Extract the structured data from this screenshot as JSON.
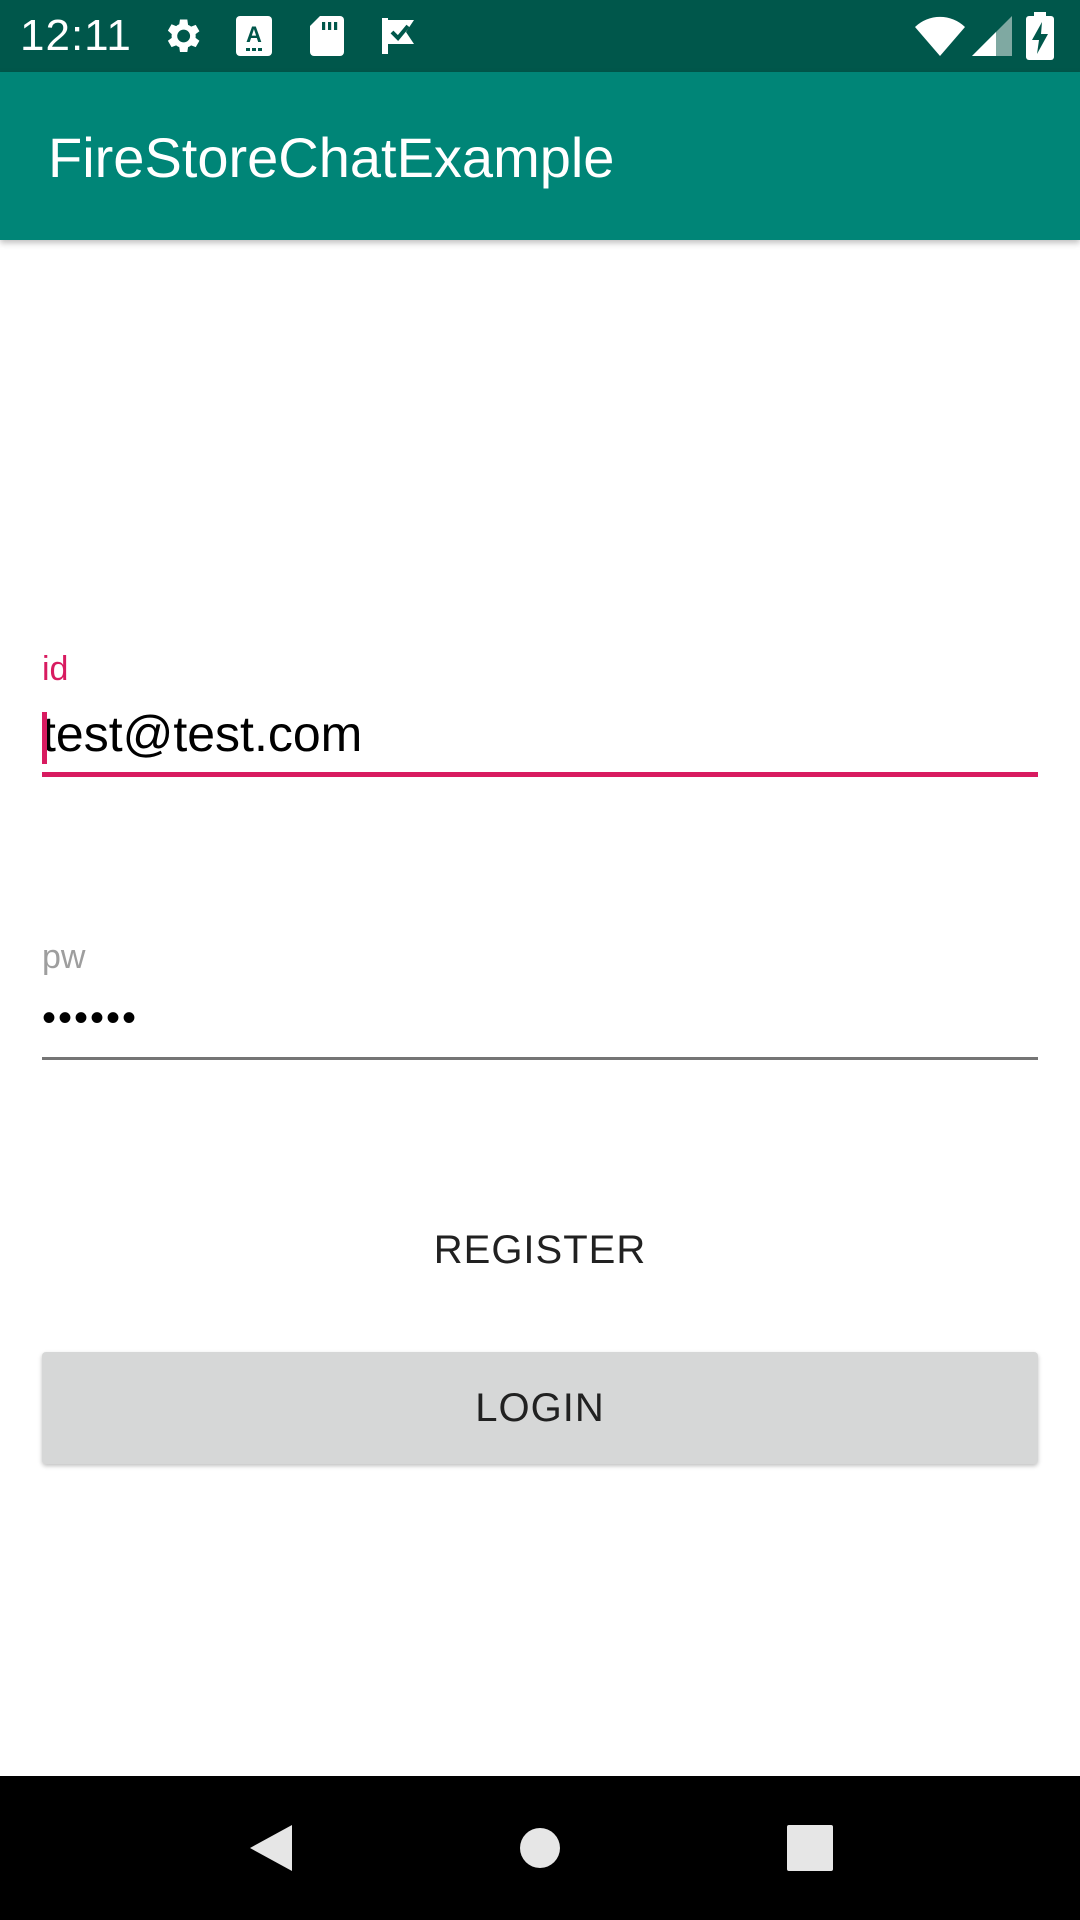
{
  "status_bar": {
    "time": "12:11",
    "icons": [
      "settings-icon",
      "a-keyboard-icon",
      "sd-card-icon",
      "check-flag-icon",
      "wifi-icon",
      "signal-icon",
      "battery-charging-icon"
    ]
  },
  "app_bar": {
    "title": "FireStoreChatExample",
    "color": "#008577"
  },
  "form": {
    "id_label": "id",
    "id_value": "test@test.com",
    "pw_label": "pw",
    "pw_value": "••••••",
    "accent_color": "#d81b60"
  },
  "buttons": {
    "register_label": "REGISTER",
    "login_label": "LOGIN"
  },
  "nav_bar": {
    "icons": [
      "back-icon",
      "home-icon",
      "recents-icon"
    ]
  }
}
